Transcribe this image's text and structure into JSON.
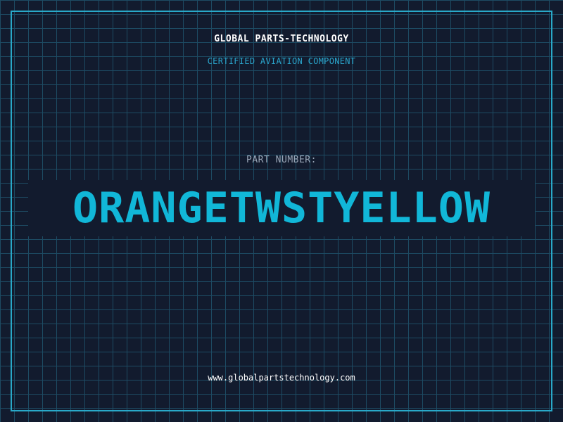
{
  "header": {
    "company": "GLOBAL PARTS-TECHNOLOGY",
    "subtitle": "CERTIFIED AVIATION COMPONENT"
  },
  "part": {
    "label": "PART NUMBER:",
    "number": "ORANGETWSTYELLOW"
  },
  "footer": {
    "url": "www.globalpartstechnology.com"
  },
  "colors": {
    "background": "#121b2e",
    "grid": "#1d4b63",
    "frame": "#29a9c9",
    "accent": "#11b7d8",
    "label": "#9aa7b8"
  }
}
